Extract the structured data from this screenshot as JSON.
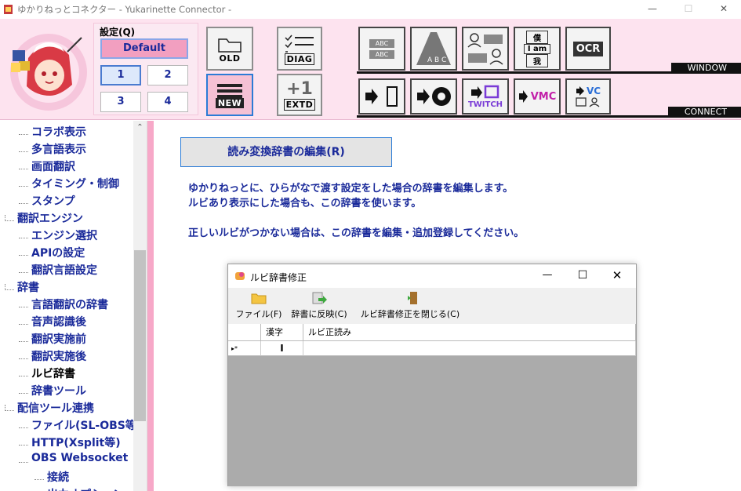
{
  "window": {
    "title": "ゆかりねっとコネクター - Yukarinette Connector -",
    "min_label": "—",
    "max_label": "☐",
    "close_label": "✕"
  },
  "presets": {
    "title": "設定(Q)",
    "default_label": "Default",
    "slots": [
      "1",
      "2",
      "3",
      "4"
    ]
  },
  "toolbar": {
    "old_label": "OLD",
    "new_label": "NEW",
    "diag_label": "DIAG",
    "extd_label": "EXTD",
    "ocr_label": "OCR",
    "vmc_label": "VMC",
    "twitch_label": "TWITCH",
    "vc_label": "VC",
    "window_label": "WINDOW",
    "connect_label": "CONNECT",
    "abc_label": "ABC",
    "i_am_label": "I am",
    "boku_label": "僕",
    "ware_label": "我"
  },
  "sidebar": {
    "items": [
      {
        "label": "コラボ表示",
        "level": 1
      },
      {
        "label": "多言語表示",
        "level": 1
      },
      {
        "label": "画面翻訳",
        "level": 1
      },
      {
        "label": "タイミング・制御",
        "level": 1
      },
      {
        "label": "スタンプ",
        "level": 1
      },
      {
        "label": "翻訳エンジン",
        "level": 0
      },
      {
        "label": "エンジン選択",
        "level": 1
      },
      {
        "label": "APIの設定",
        "level": 1
      },
      {
        "label": "翻訳言語設定",
        "level": 1
      },
      {
        "label": "辞書",
        "level": 0
      },
      {
        "label": "言語翻訳の辞書",
        "level": 1
      },
      {
        "label": "音声認識後",
        "level": 1
      },
      {
        "label": "翻訳実施前",
        "level": 1
      },
      {
        "label": "翻訳実施後",
        "level": 1
      },
      {
        "label": "ルビ辞書",
        "level": 1
      },
      {
        "label": "辞書ツール",
        "level": 1
      },
      {
        "label": "配信ツール連携",
        "level": 0
      },
      {
        "label": "ファイル(SL-OBS等)",
        "level": 1
      },
      {
        "label": "HTTP(Xsplit等)",
        "level": 1
      },
      {
        "label": "OBS Websocket",
        "level": 1
      },
      {
        "label": "接続",
        "level": 2
      },
      {
        "label": "出力オプション",
        "level": 2
      }
    ]
  },
  "main": {
    "edit_button_label": "読み変換辞書の編集(R)",
    "desc_line1": "ゆかりねっとに、ひらがなで渡す設定をした場合の辞書を編集します。",
    "desc_line2": "ルビあり表示にした場合も、この辞書を使います。",
    "desc_line3": "正しいルビがつかない場合は、この辞書を編集・追加登録してください。"
  },
  "dialog": {
    "title": "ルビ辞書修正",
    "toolbar": {
      "file_label": "ファイル(F)",
      "apply_label": "辞書に反映(C)",
      "close_label": "ルビ辞書修正を閉じる(C)"
    },
    "columns": [
      "漢字",
      "ルビ正読み"
    ],
    "new_row_marker": "▸*",
    "row_value": "I"
  }
}
